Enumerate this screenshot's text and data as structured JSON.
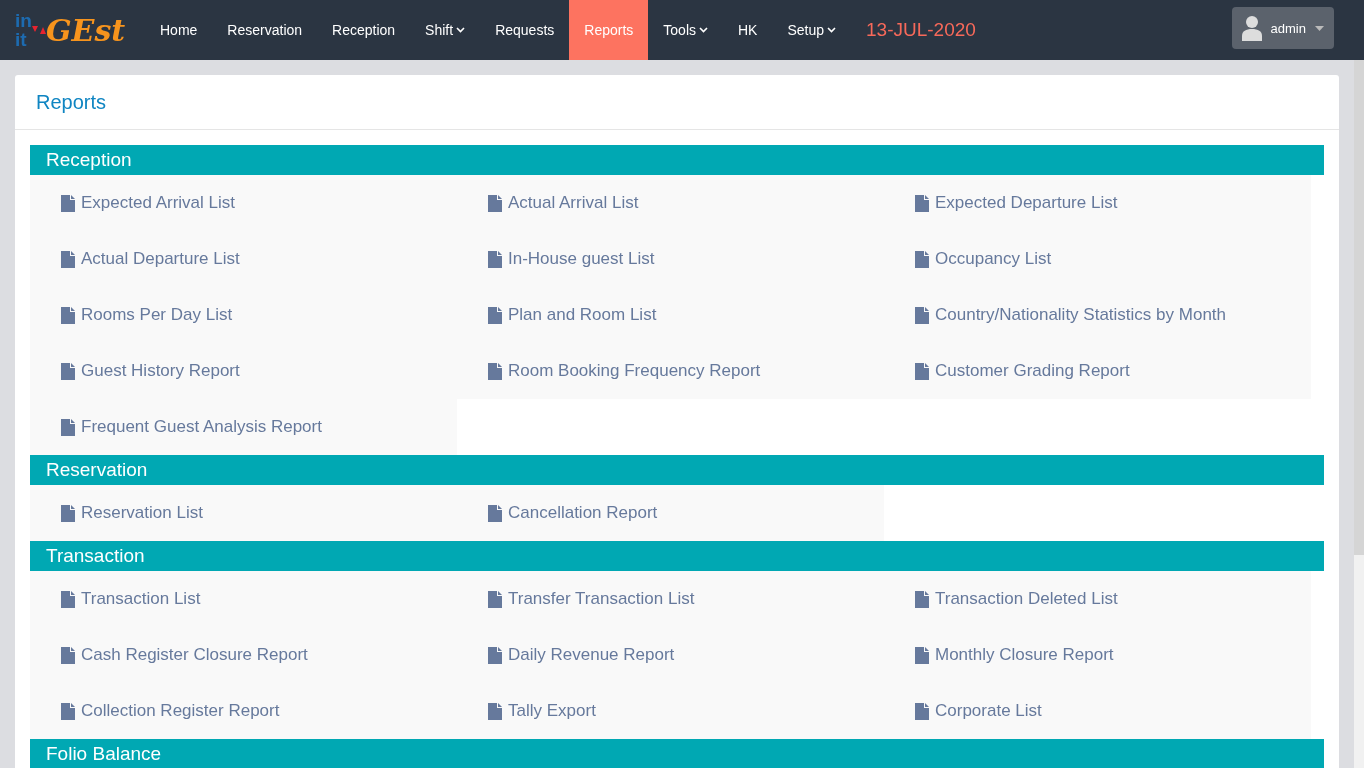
{
  "logo": {
    "top": "in",
    "bottom": "it",
    "name": "GEst"
  },
  "nav": [
    {
      "label": "Home",
      "selected": false,
      "dropdown": false
    },
    {
      "label": "Reservation",
      "selected": false,
      "dropdown": false
    },
    {
      "label": "Reception",
      "selected": false,
      "dropdown": false
    },
    {
      "label": "Shift",
      "selected": false,
      "dropdown": true
    },
    {
      "label": "Requests",
      "selected": false,
      "dropdown": false
    },
    {
      "label": "Reports",
      "selected": true,
      "dropdown": false
    },
    {
      "label": "Tools",
      "selected": false,
      "dropdown": true
    },
    {
      "label": "HK",
      "selected": false,
      "dropdown": false
    },
    {
      "label": "Setup",
      "selected": false,
      "dropdown": true
    }
  ],
  "date": "13-JUL-2020",
  "user": {
    "name": "admin"
  },
  "page_title": "Reports",
  "sections": [
    {
      "title": "Reception",
      "items": [
        "Expected Arrival List",
        "Actual Arrival List",
        "Expected Departure List",
        "Actual Departure List",
        "In-House guest List",
        "Occupancy List",
        "Rooms Per Day List",
        "Plan and Room List",
        "Country/Nationality Statistics by Month",
        "Guest History Report",
        "Room Booking Frequency Report",
        "Customer Grading Report",
        "Frequent Guest Analysis Report"
      ]
    },
    {
      "title": "Reservation",
      "items": [
        "Reservation List",
        "Cancellation Report"
      ]
    },
    {
      "title": "Transaction",
      "items": [
        "Transaction List",
        "Transfer Transaction List",
        "Transaction Deleted List",
        "Cash Register Closure Report",
        "Daily Revenue Report",
        "Monthly Closure Report",
        "Collection Register Report",
        "Tally Export",
        "Corporate List"
      ]
    },
    {
      "title": "Folio Balance"
    }
  ]
}
